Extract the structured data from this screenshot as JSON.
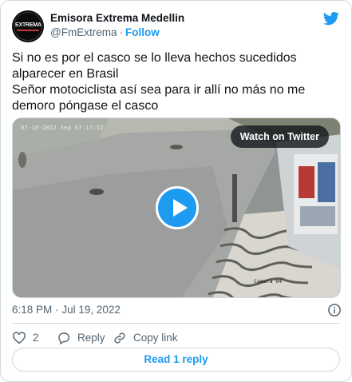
{
  "author": {
    "display_name": "Emisora Extrema Medellin",
    "handle": "@FmExtrema",
    "separator": "·",
    "follow_label": "Follow",
    "avatar_text": "EXTREMA"
  },
  "tweet": {
    "lines": [
      "Si no es por el casco se lo lleva hechos sucedidos alparecer en Brasil",
      "Señor motociclista así sea para ir allí no más no me demoro póngase el casco"
    ],
    "time": "6:18 PM",
    "separator": "·",
    "date": "Jul 19, 2022"
  },
  "media": {
    "watch_label": "Watch on Twitter",
    "camera_timestamp": "07-18-2022 Seg 07:17:52",
    "camera_label": "Camera 04"
  },
  "actions": {
    "like_count": "2",
    "reply_label": "Reply",
    "copy_link_label": "Copy link"
  },
  "read_reply_label": "Read 1 reply",
  "colors": {
    "accent": "#1d9bf0",
    "secondary_text": "#536471",
    "border": "#cfd9de"
  },
  "icons": [
    "twitter-bird-icon",
    "play-icon",
    "info-icon",
    "heart-icon",
    "reply-icon",
    "link-icon"
  ]
}
